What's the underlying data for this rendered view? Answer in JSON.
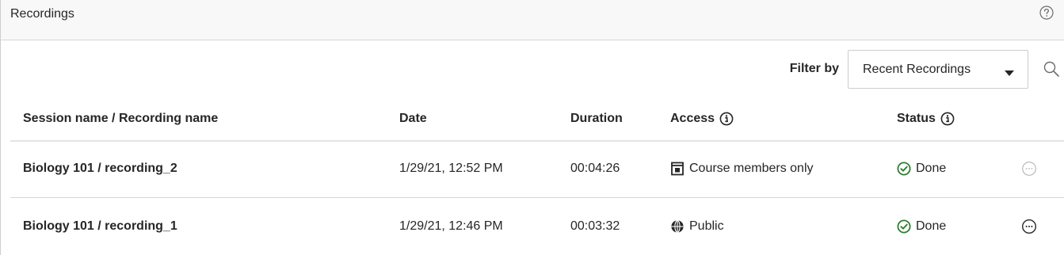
{
  "header": {
    "title": "Recordings",
    "help_icon": "question-circle-icon"
  },
  "toolbar": {
    "filter_label": "Filter by",
    "filter_value": "Recent Recordings",
    "search_icon": "search-icon"
  },
  "table": {
    "columns": {
      "name": "Session name / Recording name",
      "date": "Date",
      "duration": "Duration",
      "access": "Access",
      "status": "Status"
    },
    "rows": [
      {
        "name": "Biology 101 / recording_2",
        "date": "1/29/21, 12:52 PM",
        "duration": "00:04:26",
        "access": "Course members only",
        "access_icon": "course-members-icon",
        "status": "Done",
        "status_icon": "check-circle-icon",
        "menu_icon": "more-options-icon",
        "menu_state": "dimmed"
      },
      {
        "name": "Biology 101 / recording_1",
        "date": "1/29/21, 12:46 PM",
        "duration": "00:03:32",
        "access": "Public",
        "access_icon": "globe-icon",
        "status": "Done",
        "status_icon": "check-circle-icon",
        "menu_icon": "more-options-icon",
        "menu_state": "active"
      }
    ]
  },
  "colors": {
    "status_done": "#2e7d32",
    "text": "#262626",
    "muted_icon": "#b3b3b3"
  }
}
